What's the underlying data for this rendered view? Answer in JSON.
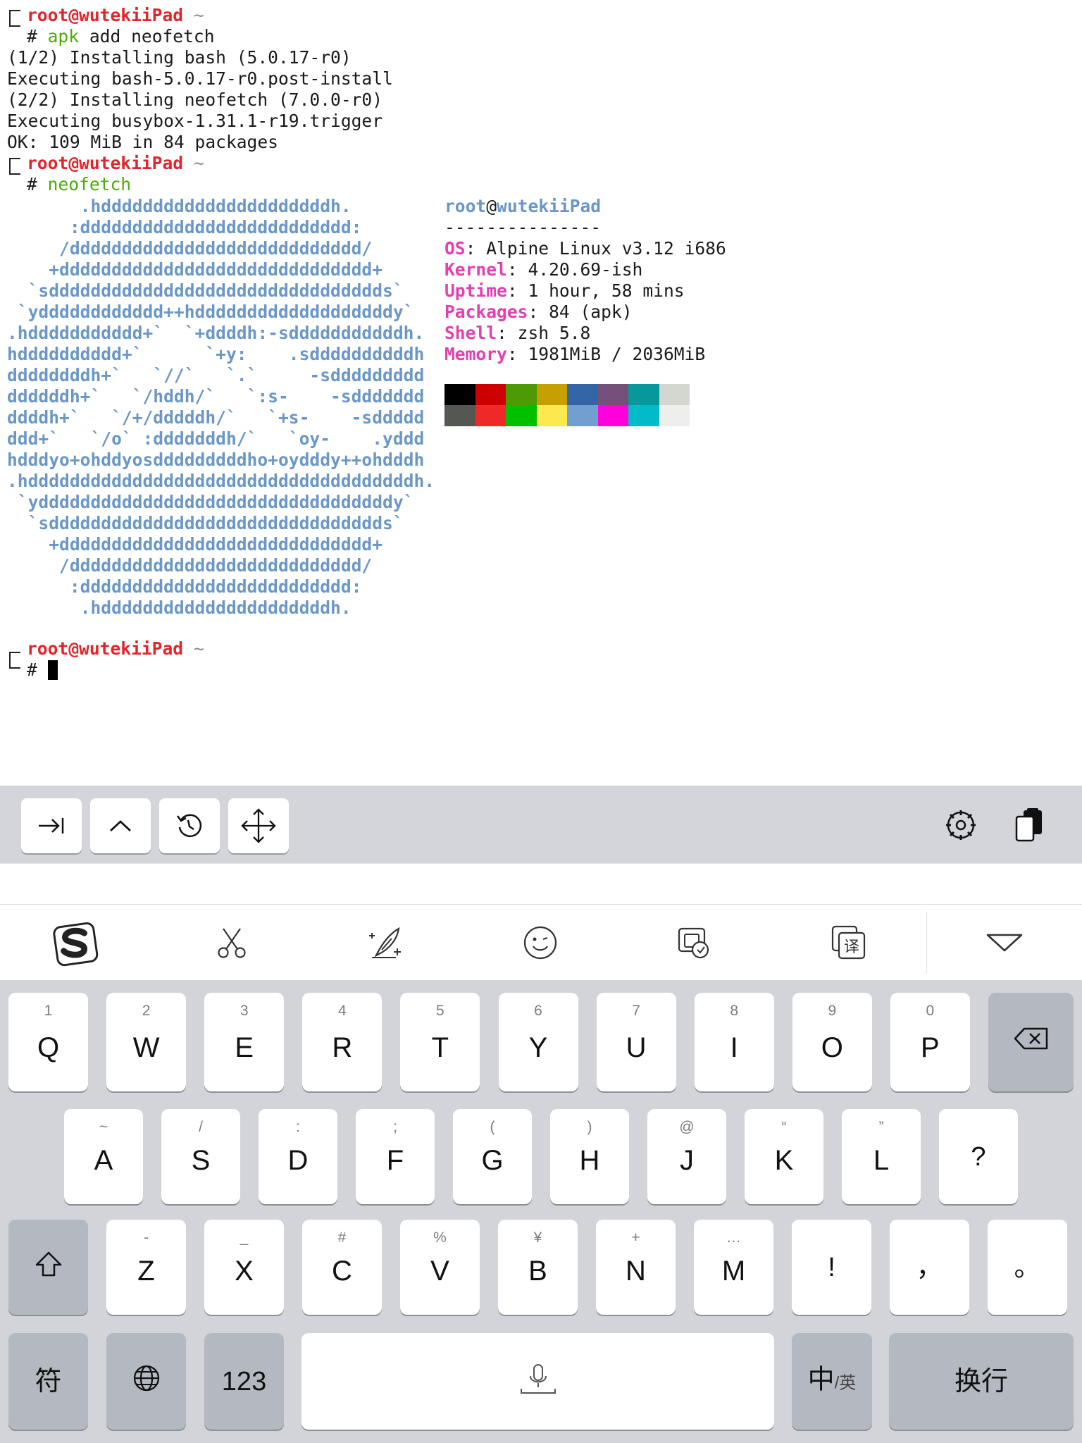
{
  "terminal": {
    "prompt_user": "root@wutekiiPad",
    "prompt_dir": "~",
    "prompt_symbol": "#",
    "cmd1_name": "apk",
    "cmd1_args": " add neofetch",
    "output": [
      "(1/2) Installing bash (5.0.17-r0)",
      "Executing bash-5.0.17-r0.post-install",
      "(2/2) Installing neofetch (7.0.0-r0)",
      "Executing busybox-1.31.1-r19.trigger",
      "OK: 109 MiB in 84 packages"
    ],
    "cmd2": "neofetch",
    "ascii_art": [
      "       .hddddddddddddddddddddddh.",
      "      :dddddddddddddddddddddddddd:",
      "     /dddddddddddddddddddddddddddd/",
      "    +dddddddddddddddddddddddddddddd+",
      "  `sdddddddddddddddddddddddddddddddds`",
      " `ydddddddddddd++hdddddddddddddddddddy`",
      ".hddddddddddd+`  `+ddddh:-sdddddddddddh.",
      "hdddddddddd+`      `+y:    .sddddddddddh",
      "ddddddddh+`   `//`   `.`     -sddddddddd",
      "ddddddh+`   `/hddh/`   `:s-    -sddddddd",
      "ddddh+`   `/+/dddddh/`   `+s-    -sddddd",
      "ddd+`   `/o` :dddddddh/`   `oy-    .yddd",
      "hdddyo+ohddyosdddddddddho+oydddy++ohdddh",
      ".hdddddddddddddddddddddddddddddddddddddh.",
      " `yddddddddddddddddddddddddddddddddddy`",
      "  `sdddddddddddddddddddddddddddddddds`",
      "    +dddddddddddddddddddddddddddddd+",
      "     /dddddddddddddddddddddddddddd/",
      "      :dddddddddddddddddddddddddd:",
      "       .hddddddddddddddddddddddh."
    ],
    "info_user": "root",
    "info_at": "@",
    "info_host": "wutekiiPad",
    "info_sep": "---------------",
    "info": [
      {
        "key": "OS",
        "value": ": Alpine Linux v3.12 i686"
      },
      {
        "key": "Kernel",
        "value": ": 4.20.69-ish"
      },
      {
        "key": "Uptime",
        "value": ": 1 hour, 58 mins"
      },
      {
        "key": "Packages",
        "value": ": 84 (apk)"
      },
      {
        "key": "Shell",
        "value": ": zsh 5.8"
      },
      {
        "key": "Memory",
        "value": ": 1981MiB / 2036MiB"
      }
    ],
    "palette_row1": [
      "#000000",
      "#cc0000",
      "#4e9a06",
      "#c4a000",
      "#3465a4",
      "#75507b",
      "#06989a",
      "#d3d7cf"
    ],
    "palette_row2": [
      "#555753",
      "#ef2929",
      "#00c000",
      "#fce94f",
      "#729fcf",
      "#ff00dd",
      "#00bcc8",
      "#eeeeec"
    ]
  },
  "toolbar": {
    "left_buttons": [
      "tab-icon",
      "ctrl-icon",
      "history-icon",
      "move-icon"
    ],
    "right_buttons": [
      "settings-icon",
      "paste-icon"
    ]
  },
  "ime_bar": {
    "items": [
      "sogou-logo-icon",
      "scissors-icon",
      "handwriting-icon",
      "emoji-icon",
      "screenshot-icon",
      "translate-icon",
      "hide-keyboard-icon"
    ],
    "translate_char": "译"
  },
  "keyboard": {
    "row1": [
      {
        "hint": "1",
        "label": "Q"
      },
      {
        "hint": "2",
        "label": "W"
      },
      {
        "hint": "3",
        "label": "E"
      },
      {
        "hint": "4",
        "label": "R"
      },
      {
        "hint": "5",
        "label": "T"
      },
      {
        "hint": "6",
        "label": "Y"
      },
      {
        "hint": "7",
        "label": "U"
      },
      {
        "hint": "8",
        "label": "I"
      },
      {
        "hint": "9",
        "label": "O"
      },
      {
        "hint": "0",
        "label": "P"
      }
    ],
    "row2": [
      {
        "hint": "~",
        "label": "A"
      },
      {
        "hint": "/",
        "label": "S"
      },
      {
        "hint": ":",
        "label": "D"
      },
      {
        "hint": ";",
        "label": "F"
      },
      {
        "hint": "(",
        "label": "G"
      },
      {
        "hint": ")",
        "label": "H"
      },
      {
        "hint": "@",
        "label": "J"
      },
      {
        "hint": "“",
        "label": "K"
      },
      {
        "hint": "”",
        "label": "L"
      },
      {
        "hint": "",
        "label": "?"
      }
    ],
    "row3": [
      {
        "hint": "-",
        "label": "Z"
      },
      {
        "hint": "_",
        "label": "X"
      },
      {
        "hint": "#",
        "label": "C"
      },
      {
        "hint": "%",
        "label": "V"
      },
      {
        "hint": "¥",
        "label": "B"
      },
      {
        "hint": "+",
        "label": "N"
      },
      {
        "hint": "…",
        "label": "M"
      },
      {
        "hint": "",
        "label": "!"
      },
      {
        "hint": "",
        "label": "，"
      },
      {
        "hint": "",
        "label": "。"
      }
    ],
    "symbols_label": "符",
    "numbers_label": "123",
    "lang_main": "中",
    "lang_sub": "/英",
    "return_label": "换行"
  }
}
